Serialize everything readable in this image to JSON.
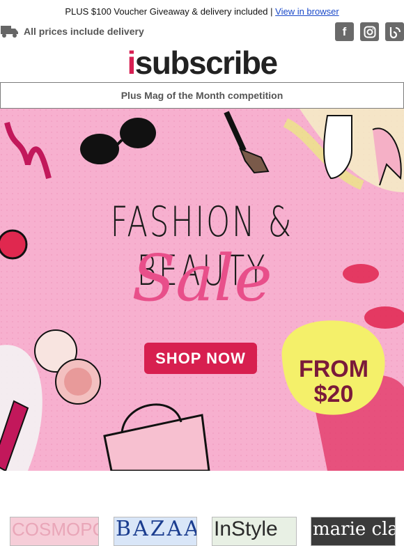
{
  "header": {
    "promo_text": "PLUS $100 Voucher Giveaway & delivery included | ",
    "view_link": "View in browser",
    "delivery_text": "All prices include delivery",
    "social": [
      "f",
      "ig",
      "b"
    ]
  },
  "logo": {
    "i": "i",
    "rest": "subscribe"
  },
  "competition": "Plus Mag of the Month competition",
  "banner": {
    "line1": "FASHION & BEAUTY",
    "line2": "Sale",
    "cta": "SHOP NOW",
    "badge_line1": "FROM",
    "badge_line2": "$20"
  },
  "magazines": [
    {
      "name": "COSMOPOLITAN",
      "color": "#e9a6b8"
    },
    {
      "name": "BAZAAR",
      "color": "#1b3d8f"
    },
    {
      "name": "InStyle",
      "color": "#2a2a2a"
    },
    {
      "name": "marie claire",
      "color": "#ffffff"
    }
  ],
  "colors": {
    "brand": "#d61f52",
    "link": "#1a49c9",
    "banner_bg": "#f7b0cf",
    "cta": "#d71f4f"
  }
}
